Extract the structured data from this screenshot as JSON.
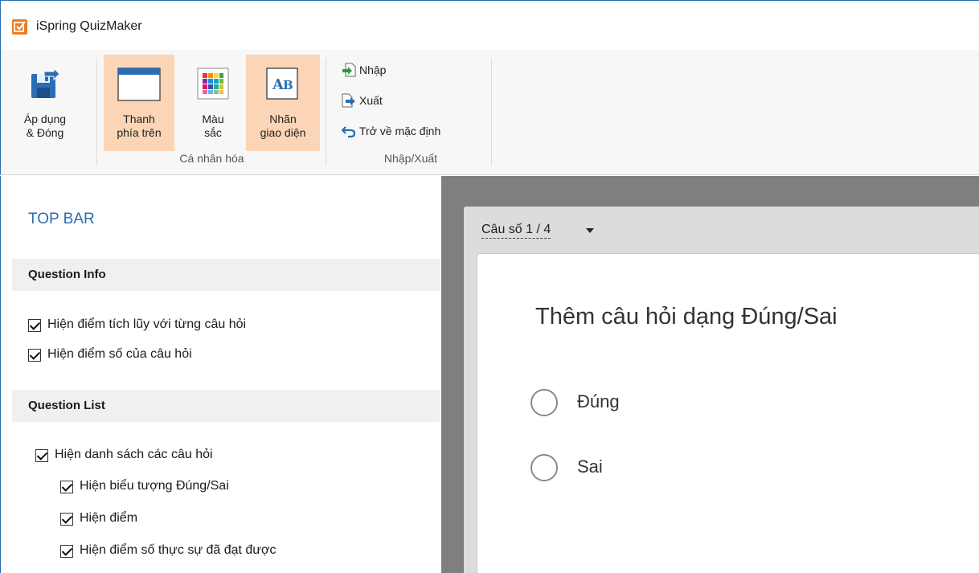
{
  "window": {
    "title": "iSpring QuizMaker"
  },
  "ribbon": {
    "apply_close": {
      "line1": "Áp dụng",
      "line2": "& Đóng"
    },
    "top_bar": {
      "line1": "Thanh",
      "line2": "phía trên"
    },
    "colors": {
      "line1": "Màu",
      "line2": "sắc"
    },
    "labels": {
      "line1": "Nhãn",
      "line2": "giao diện"
    },
    "group_personalize": "Cá nhân hóa",
    "import": "Nhập",
    "export": "Xuất",
    "reset": "Trở về mặc định",
    "group_import_export": "Nhập/Xuất"
  },
  "panel": {
    "title": "TOP BAR",
    "question_info": {
      "heading": "Question Info",
      "items": [
        {
          "label": "Hiện điểm tích lũy với từng câu hỏi",
          "checked": true
        },
        {
          "label": "Hiện điểm số của câu hỏi",
          "checked": true
        }
      ]
    },
    "question_list": {
      "heading": "Question List",
      "items": [
        {
          "label": "Hiện danh sách các câu hỏi",
          "checked": true
        },
        {
          "label": "Hiện biểu tượng Đúng/Sai",
          "checked": true
        },
        {
          "label": "Hiện điểm",
          "checked": true
        },
        {
          "label": "Hiện điểm số thực sự đã đạt được",
          "checked": true
        }
      ]
    }
  },
  "preview": {
    "question_counter": "Câu số 1 / 4",
    "question_text": "Thêm câu hỏi dạng Đúng/Sai",
    "answers": [
      "Đúng",
      "Sai"
    ]
  },
  "colors": {
    "accent": "#2b6cb0",
    "active_button": "#fbd5b5",
    "app_icon": "#f07c22",
    "preview_bg": "#7f7f7f"
  }
}
